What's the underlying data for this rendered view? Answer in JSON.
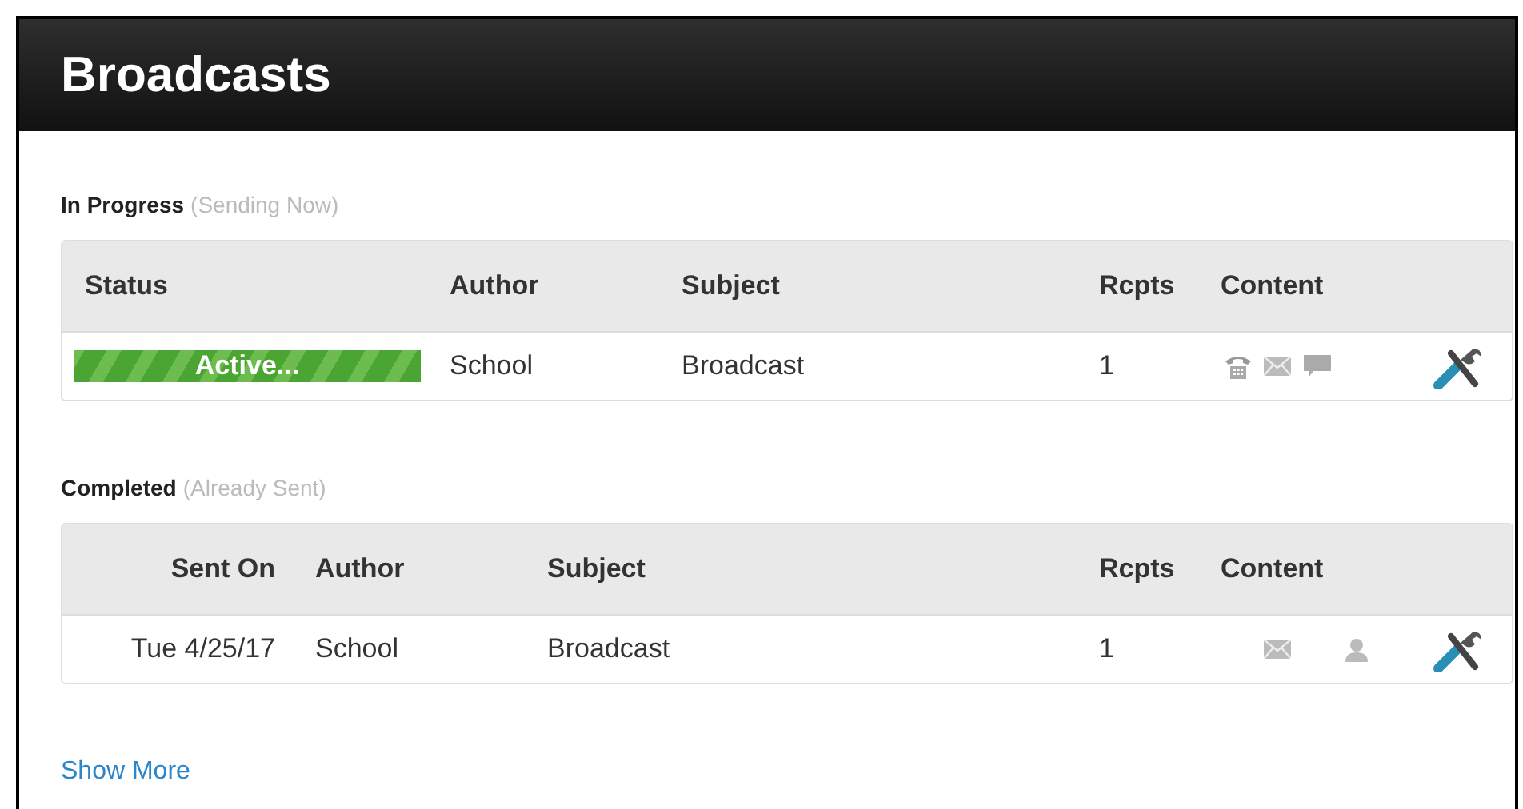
{
  "title": "Broadcasts",
  "sections": [
    {
      "heading": "In Progress",
      "note": "(Sending Now)",
      "kind": "progress",
      "columns": [
        "Status",
        "Author",
        "Subject",
        "Rcpts",
        "Content"
      ],
      "rows": [
        {
          "status": "Active...",
          "author": "School",
          "subject": "Broadcast",
          "rcpts": "1",
          "content": [
            {
              "kind": "phone"
            },
            {
              "kind": "mail"
            },
            {
              "kind": "chat"
            }
          ]
        }
      ]
    },
    {
      "heading": "Completed",
      "note": "(Already Sent)",
      "kind": "done",
      "columns": [
        "Sent On",
        "Author",
        "Subject",
        "Rcpts",
        "Content"
      ],
      "rows": [
        {
          "status": "Tue 4/25/17",
          "author": "School",
          "subject": "Broadcast",
          "rcpts": "1",
          "content": [
            {
              "kind": "mail"
            },
            {
              "kind": "person"
            }
          ]
        }
      ]
    }
  ],
  "show_more": "Show More"
}
